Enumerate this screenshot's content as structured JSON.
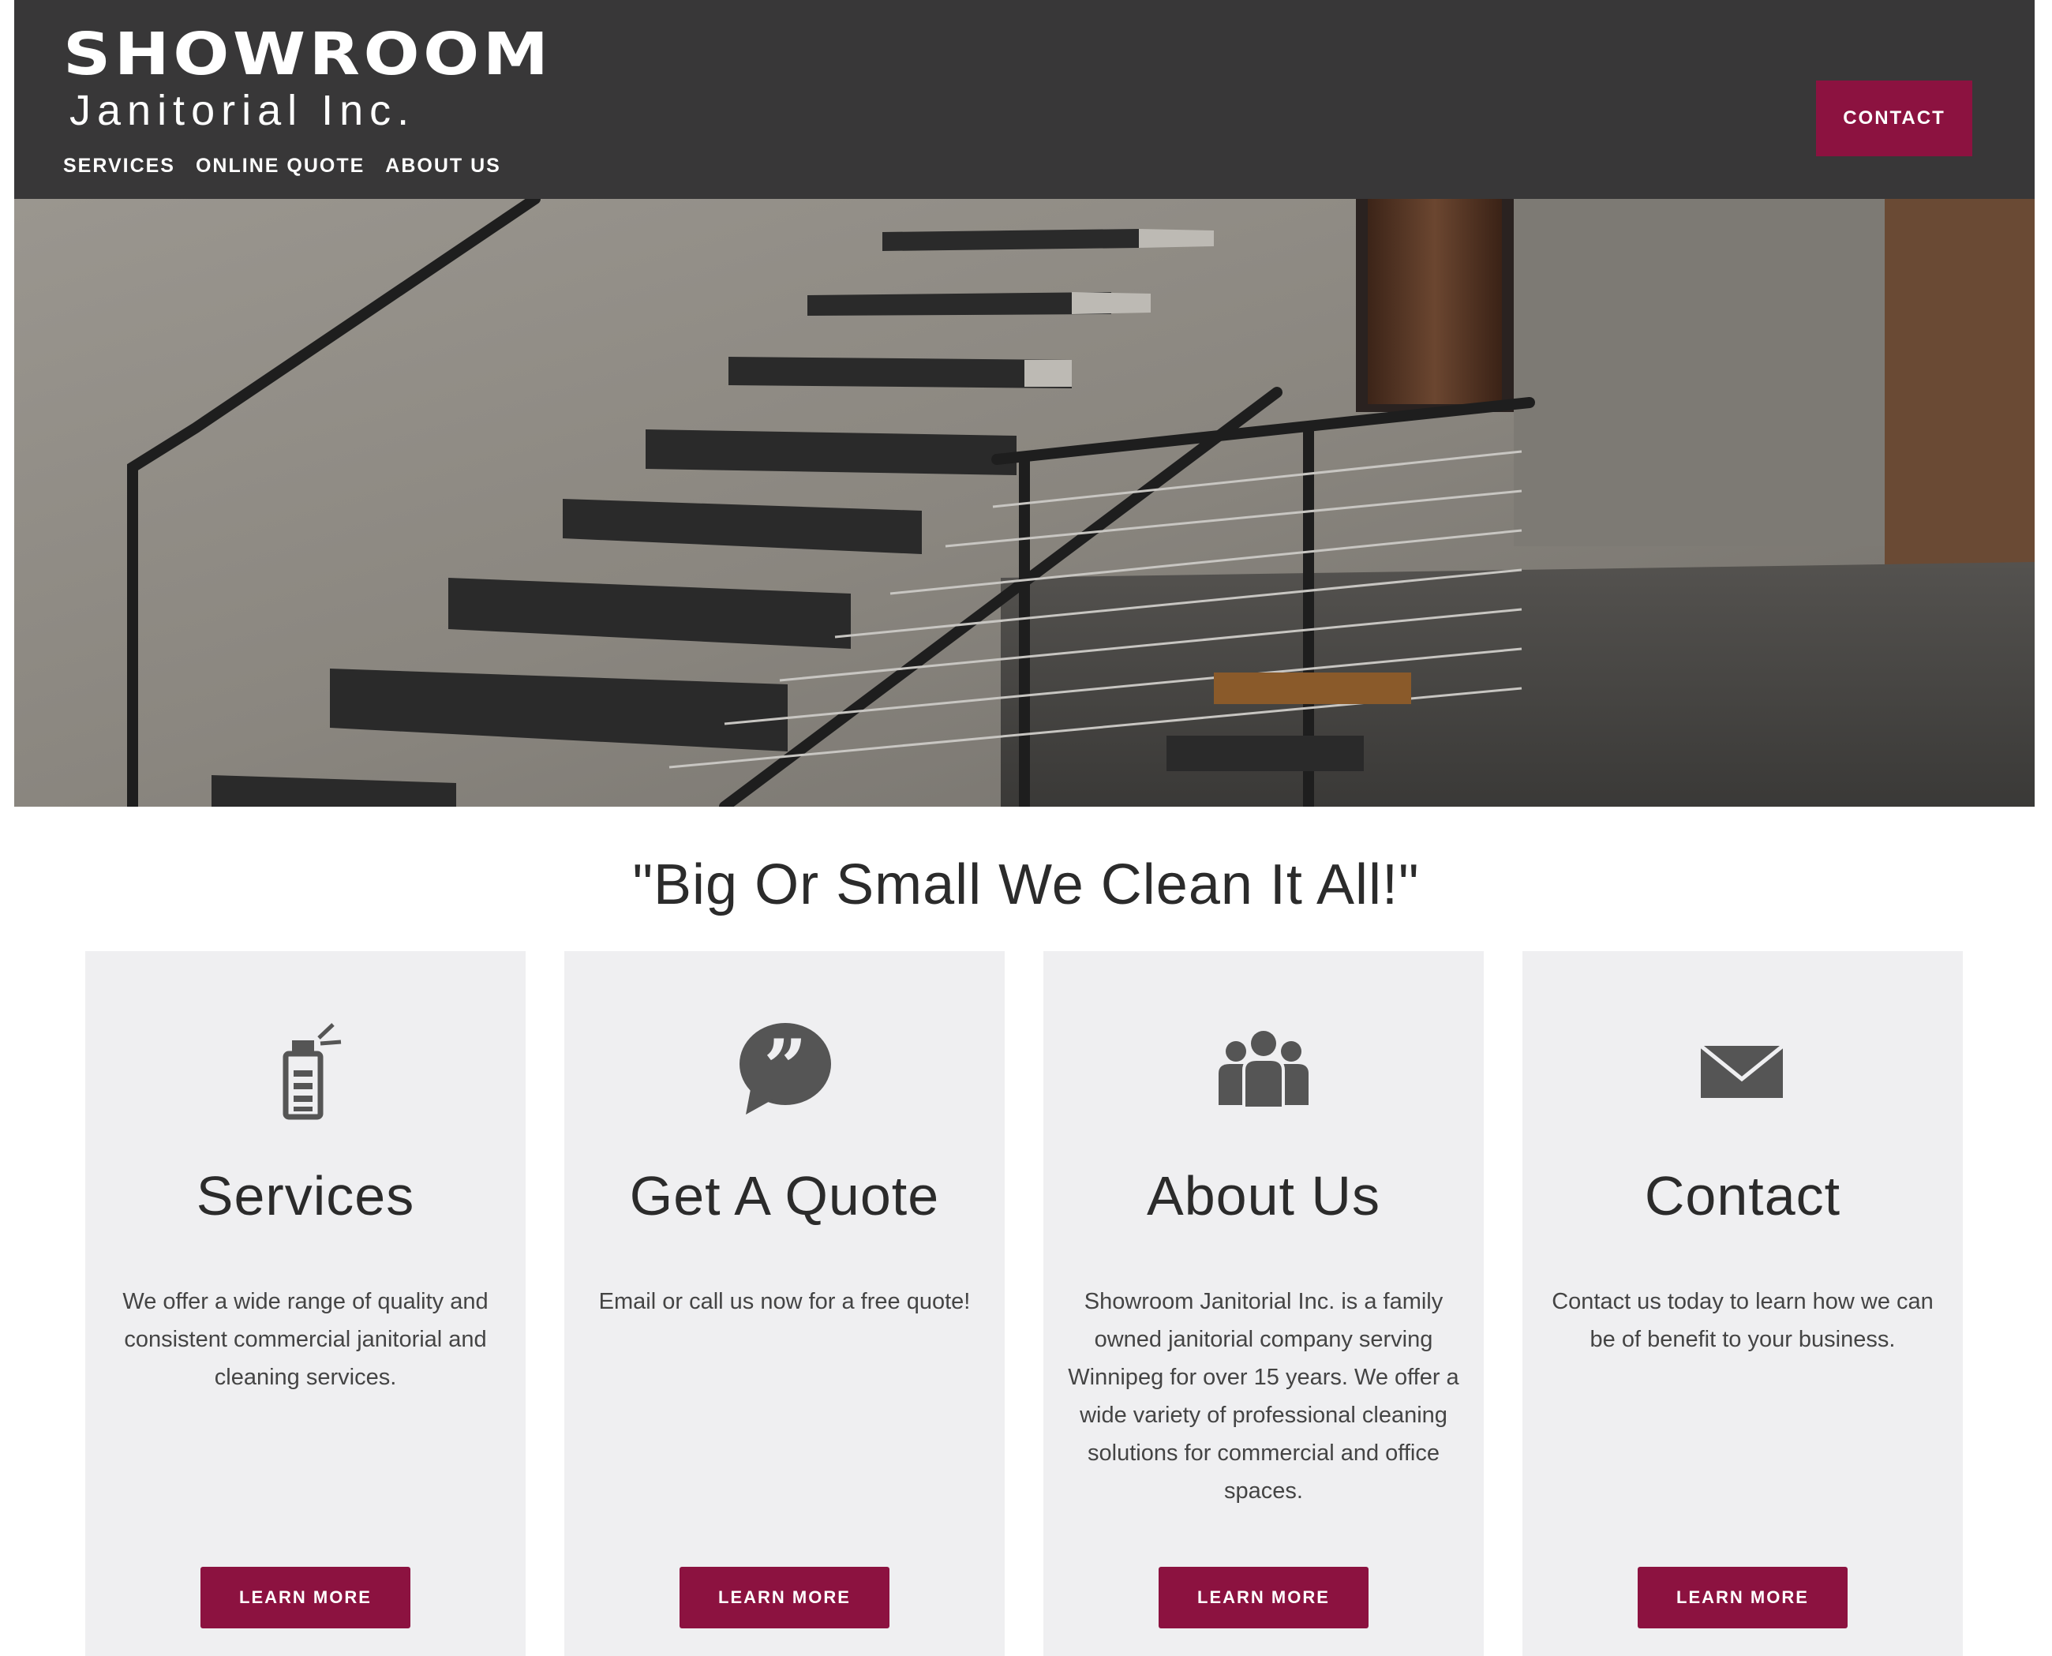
{
  "header": {
    "logo_main": "SHOWROOM",
    "logo_sub": "Janitorial Inc.",
    "nav": [
      "SERVICES",
      "ONLINE QUOTE",
      "ABOUT US"
    ],
    "contact_label": "CONTACT"
  },
  "hero": {
    "image": "floating-concrete-staircase-photo"
  },
  "tagline": "\"Big Or Small We Clean It All!\"",
  "cards": [
    {
      "icon": "spray-bottle-icon",
      "title": "Services",
      "text": "We offer a wide range of quality and consistent commercial janitorial and cleaning services.",
      "button": "LEARN MORE"
    },
    {
      "icon": "quote-bubble-icon",
      "title": "Get A Quote",
      "text": "Email or call us now for a free quote!",
      "button": "LEARN MORE"
    },
    {
      "icon": "people-group-icon",
      "title": "About Us",
      "text": "Showroom Janitorial Inc. is a family owned janitorial company serving Winnipeg for over 15 years.  We offer a wide variety of professional cleaning solutions for commercial and office spaces.",
      "button": "LEARN MORE"
    },
    {
      "icon": "envelope-icon",
      "title": "Contact",
      "text": "Contact us today to learn how we can be of benefit to your business.",
      "button": "LEARN MORE"
    }
  ],
  "colors": {
    "header_bg": "#383738",
    "accent": "#8c1240",
    "card_bg": "#efeff1",
    "icon": "#555555"
  }
}
